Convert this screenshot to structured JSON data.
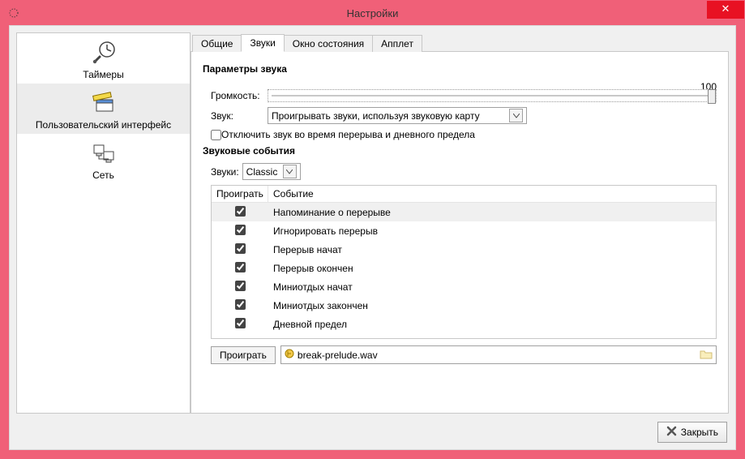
{
  "window": {
    "title": "Настройки",
    "close_label": "Закрыть"
  },
  "sidebar": {
    "items": [
      {
        "label": "Таймеры"
      },
      {
        "label": "Пользовательский интерфейс"
      },
      {
        "label": "Сеть"
      }
    ]
  },
  "tabs": [
    {
      "label": "Общие"
    },
    {
      "label": "Звуки"
    },
    {
      "label": "Окно состояния"
    },
    {
      "label": "Апплет"
    }
  ],
  "sound": {
    "params_header": "Параметры звука",
    "volume_label": "Громкость:",
    "volume_value": "100",
    "sound_label": "Звук:",
    "sound_select": "Проигрывать звуки, используя звуковую карту",
    "mute_label": "Отключить звук во время перерыва и дневного предела",
    "events_header": "Звуковые события",
    "sounds_label": "Звуки:",
    "sounds_select": "Classic",
    "col_play": "Проиграть",
    "col_event": "Событие",
    "events": [
      {
        "label": "Напоминание о перерыве"
      },
      {
        "label": "Игнорировать перерыв"
      },
      {
        "label": "Перерыв начат"
      },
      {
        "label": "Перерыв окончен"
      },
      {
        "label": "Миниотдых начат"
      },
      {
        "label": "Миниотдых закончен"
      },
      {
        "label": "Дневной предел"
      }
    ],
    "play_btn": "Проиграть",
    "file_name": "break-prelude.wav"
  }
}
